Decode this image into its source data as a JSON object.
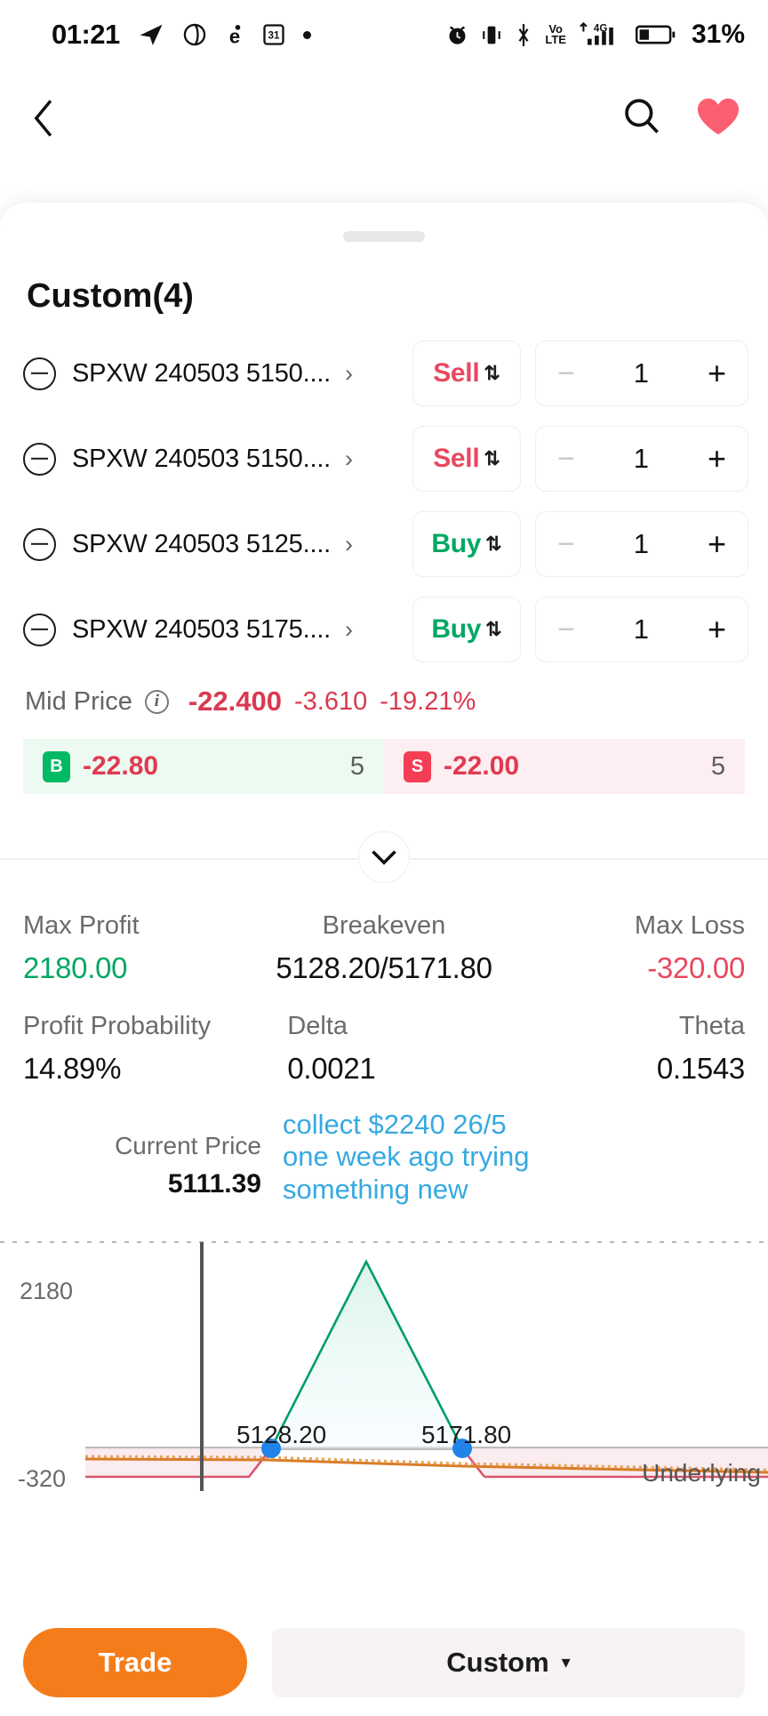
{
  "statusbar": {
    "time": "01:21",
    "battery_pct": "31%",
    "volte_top": "Vo",
    "volte_bottom": "LTE",
    "network": "4G",
    "calendar_day": "31",
    "icons": [
      "telegram-icon",
      "opera-icon",
      "e-app-icon",
      "calendar-icon",
      "dot-icon",
      "alarm-icon",
      "vibrate-icon",
      "bluetooth-icon",
      "volte-icon",
      "signal-icon",
      "battery-icon"
    ]
  },
  "navbar": {
    "back_icon": "chevron-left-icon",
    "search_icon": "search-icon",
    "favorite_icon": "heart-icon",
    "favorite_color": "#fb5f72"
  },
  "sheet": {
    "title": "Custom(4)"
  },
  "legs": [
    {
      "name": "SPXW 240503 5150....",
      "side": "Sell",
      "qty": "1",
      "side_type": "sell"
    },
    {
      "name": "SPXW 240503 5150....",
      "side": "Sell",
      "qty": "1",
      "side_type": "sell"
    },
    {
      "name": "SPXW 240503 5125....",
      "side": "Buy",
      "qty": "1",
      "side_type": "buy"
    },
    {
      "name": "SPXW 240503 5175....",
      "side": "Buy",
      "qty": "1",
      "side_type": "buy"
    }
  ],
  "stepper": {
    "minus": "−",
    "plus": "+"
  },
  "mid_price": {
    "label": "Mid Price",
    "info_glyph": "i",
    "value": "-22.400",
    "change": "-3.610",
    "change_pct": "-19.21%",
    "color": "#d9394f"
  },
  "bid": {
    "badge": "B",
    "price": "-22.80",
    "qty": "5"
  },
  "ask": {
    "badge": "S",
    "price": "-22.00",
    "qty": "5"
  },
  "collapse": {
    "icon": "chevron-down-icon"
  },
  "stats": {
    "max_profit_label": "Max Profit",
    "max_profit_value": "2180.00",
    "breakeven_label": "Breakeven",
    "breakeven_value": "5128.20/5171.80",
    "max_loss_label": "Max Loss",
    "max_loss_value": "-320.00",
    "profit_prob_label": "Profit Probability",
    "profit_prob_value": "14.89%",
    "delta_label": "Delta",
    "delta_value": "0.0021",
    "theta_label": "Theta",
    "theta_value": "0.1543"
  },
  "current_price": {
    "label": "Current Price",
    "value": "5111.39"
  },
  "note": {
    "text": "collect $2240 26/5 one week ago trying something new",
    "color": "#35a9e0"
  },
  "chart_data": {
    "type": "line",
    "title": "",
    "xlabel": "Underlying",
    "ylabel": "",
    "ylim": [
      -320,
      2180
    ],
    "y_ticks": [
      "2180",
      "-320"
    ],
    "grid": true,
    "legend": "none",
    "current_price_marker": 5111.39,
    "breakeven_labels": [
      "5128.20",
      "5171.80"
    ],
    "series": [
      {
        "name": "Expiration P/L",
        "color": "#009d6e",
        "x": [
          5050,
          5125,
          5128.2,
          5150,
          5171.8,
          5175,
          5260
        ],
        "y": [
          -320,
          -320,
          0,
          2180,
          0,
          -320,
          -320
        ]
      },
      {
        "name": "Current P/L",
        "color": "#d97d28",
        "x": [
          5050,
          5150,
          5260
        ],
        "y": [
          95,
          60,
          10
        ]
      }
    ],
    "zero_line": 0,
    "breakeven_points": [
      {
        "x": 5128.2,
        "y": 0
      },
      {
        "x": 5171.8,
        "y": 0
      }
    ]
  },
  "bottombar": {
    "trade_label": "Trade",
    "strategy_label": "Custom",
    "caret": "▾",
    "trade_color": "#f57c1a"
  }
}
